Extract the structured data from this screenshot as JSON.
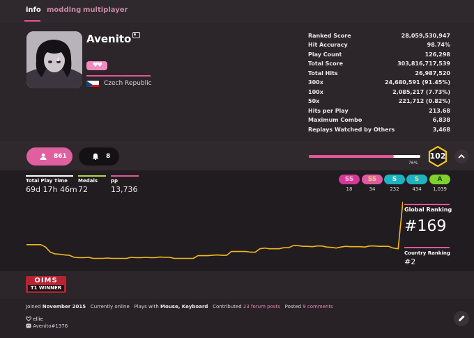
{
  "tabs": [
    {
      "label": "info"
    },
    {
      "label": "modding"
    },
    {
      "label": "multiplayer"
    }
  ],
  "profile": {
    "username": "Avenito",
    "supporter_hearts": "♥♥",
    "country": "Czech Republic"
  },
  "stats": [
    {
      "label": "Ranked Score",
      "value": "28,059,530,947"
    },
    {
      "label": "Hit Accuracy",
      "value": "98.74%"
    },
    {
      "label": "Play Count",
      "value": "126,298"
    },
    {
      "label": "Total Score",
      "value": "303,816,717,539"
    },
    {
      "label": "Total Hits",
      "value": "26,987,520"
    },
    {
      "label": "300x",
      "value": "24,680,591 (91.45%)"
    },
    {
      "label": "100x",
      "value": "2,085,217 (7.73%)"
    },
    {
      "label": "50x",
      "value": "221,712 (0.82%)"
    },
    {
      "label": "Hits per Play",
      "value": "213.68"
    },
    {
      "label": "Maximum Combo",
      "value": "6,838"
    },
    {
      "label": "Replays Watched by Others",
      "value": "3,468"
    }
  ],
  "buttons": {
    "followers": "861",
    "mapping_subscribers": "8"
  },
  "level": {
    "value": "102",
    "progress_label": "76%",
    "progress": 0.76
  },
  "details": [
    {
      "label": "Total Play Time",
      "value": "69d 17h 46m",
      "color": "#ffffff"
    },
    {
      "label": "Medals",
      "value": "72",
      "color": "#b3d944"
    },
    {
      "label": "pp",
      "value": "13,736",
      "color": "#e6559a"
    }
  ],
  "grades": [
    {
      "label": "SS",
      "count": "18",
      "bg": "#d6379a",
      "fg": "#f5c4dc"
    },
    {
      "label": "SS",
      "count": "34",
      "bg": "#e05aa2",
      "fg": "#ffd27a"
    },
    {
      "label": "S",
      "count": "232",
      "bg": "#1db4c2",
      "fg": "#e8f6f8"
    },
    {
      "label": "S",
      "count": "434",
      "bg": "#1db4c2",
      "fg": "#ffd27a"
    },
    {
      "label": "A",
      "count": "1,039",
      "bg": "#7fd12e",
      "fg": "#1d4a10"
    }
  ],
  "ranking": {
    "global_label": "Global Ranking",
    "global_value": "#169",
    "country_label": "Country Ranking",
    "country_value": "#2"
  },
  "chart_data": {
    "type": "line",
    "title": "",
    "xlabel": "",
    "ylabel": "",
    "y_inverted": true,
    "series": [
      {
        "values": [
          1.0,
          1.0,
          1.0,
          1.0,
          0.93,
          0.78,
          0.73,
          0.72,
          0.7,
          0.69,
          0.63,
          0.62,
          0.62,
          0.63,
          0.6,
          0.6,
          0.6,
          0.61,
          0.6,
          0.6,
          0.6,
          0.6,
          0.63,
          0.62,
          0.62,
          0.63,
          0.62,
          0.62,
          0.64,
          0.63,
          0.63,
          0.6,
          0.6,
          0.6,
          0.6,
          0.6,
          0.68,
          0.68,
          0.68,
          0.69,
          0.7,
          0.69,
          0.69,
          0.8,
          0.8,
          0.8,
          0.8,
          0.78,
          0.78,
          0.88,
          0.9,
          0.88,
          0.88,
          0.88,
          0.91,
          0.91,
          0.97,
          0.97,
          0.95,
          0.95,
          0.94,
          0.96,
          0.96,
          0.93,
          0.92,
          0.9,
          0.93,
          0.95,
          0.94,
          0.94,
          0.94,
          0.93,
          0.96,
          0.96,
          0.95,
          0.95,
          0.95,
          0.9,
          0.88,
          2.25
        ]
      }
    ]
  },
  "badge": {
    "line1": "OIMS",
    "line2": "T1 WINNER"
  },
  "footer": {
    "joined_prefix": "Joined",
    "joined_date": "November 2015",
    "online": "Currently online",
    "plays_prefix": "Plays with",
    "plays_with": "Mouse, Keyboard",
    "contributed_prefix": "Contributed",
    "forum_posts": "23 forum posts",
    "posted_prefix": "Posted",
    "comments": "9 comments",
    "interest": "ellie",
    "discord": "Avenito#1376"
  },
  "colors": {
    "accent": "#e6559a",
    "background": "#211c20",
    "chart_line": "#f2b81e",
    "level_badge": "#f2c81e"
  },
  "icons": [
    "profile-card-icon",
    "user-icon",
    "bell-icon",
    "chevron-up-icon",
    "pencil-icon",
    "heart-outline-icon",
    "discord-icon"
  ]
}
